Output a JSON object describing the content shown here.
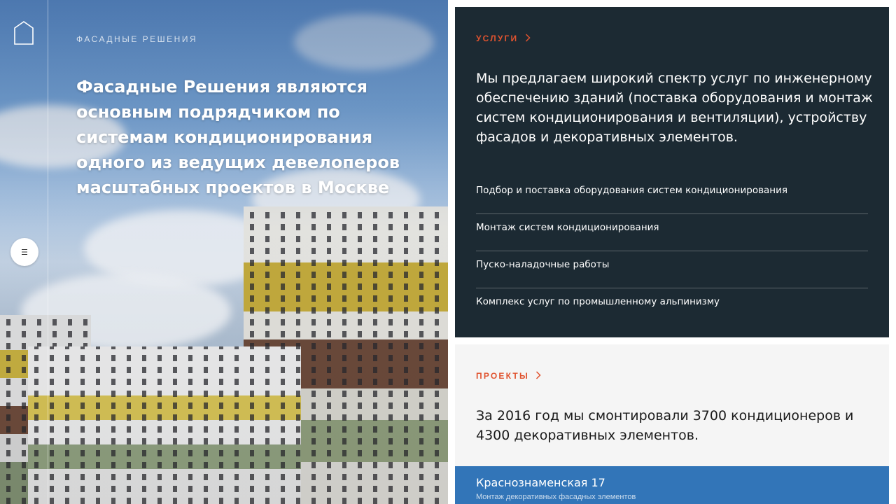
{
  "hero": {
    "kicker": "ФАСАДНЫЕ РЕШЕНИЯ",
    "headline": "Фасадные Решения являются основным подрядчиком по системам кондиционирования одного из ведущих девелоперов масштабных проектов в Москве",
    "logo_icon": "house-outline-icon",
    "menu_icon": "hamburger-menu-icon"
  },
  "services": {
    "label": "УСЛУГИ",
    "intro": "Мы предлагаем широкий спектр услуг по инженерному обеспечению зданий (поставка оборудования и монтаж систем кондиционирования и вентиляции), устройству фасадов и декоративных элементов.",
    "items": [
      "Подбор и поставка оборудования систем кондиционирования",
      "Монтаж систем кондиционирования",
      "Пуско-наладочные работы",
      "Комплекс услуг по промышленному альпинизму"
    ]
  },
  "projects": {
    "label": "ПРОЕКТЫ",
    "summary": "За 2016 год мы смонтировали 3700 кондиционеров и 4300 декоративных элементов.",
    "card": {
      "title": "Краснознаменская 17",
      "subtitle": "Монтаж декоративных фасадных элементов"
    }
  },
  "colors": {
    "dark_panel": "#1c2a33",
    "accent": "#e0532f",
    "project_blue": "#3275b8",
    "light_panel": "#f5f5f5"
  }
}
